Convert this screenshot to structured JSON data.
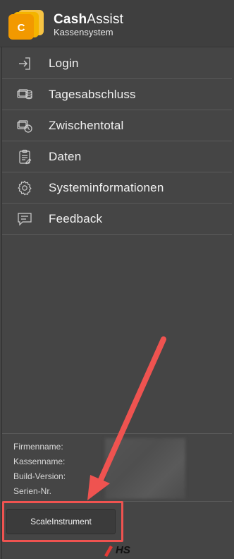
{
  "app": {
    "logo_letter": "C",
    "title_bold": "Cash",
    "title_light": "Assist",
    "subtitle": "Kassensystem",
    "logo_color": "#f4b400",
    "logo_letter_color": "#ffffff"
  },
  "nav": {
    "items": [
      {
        "label": "Login",
        "icon": "login-icon"
      },
      {
        "label": "Tagesabschluss",
        "icon": "coins-icon"
      },
      {
        "label": "Zwischentotal",
        "icon": "cash-clock-icon"
      },
      {
        "label": "Daten",
        "icon": "clipboard-icon"
      },
      {
        "label": "Systeminformationen",
        "icon": "gear-icon"
      },
      {
        "label": "Feedback",
        "icon": "chat-icon"
      }
    ]
  },
  "info": {
    "firmenname_label": "Firmenname:",
    "kassenname_label": "Kassenname:",
    "build_label": "Build-Version:",
    "serien_label": "Serien-Nr."
  },
  "footer": {
    "scale_button_label": "ScaleInstrument",
    "brand": "HS"
  },
  "colors": {
    "background": "#454545",
    "highlight": "#ef5350",
    "accent": "#f4b400"
  }
}
